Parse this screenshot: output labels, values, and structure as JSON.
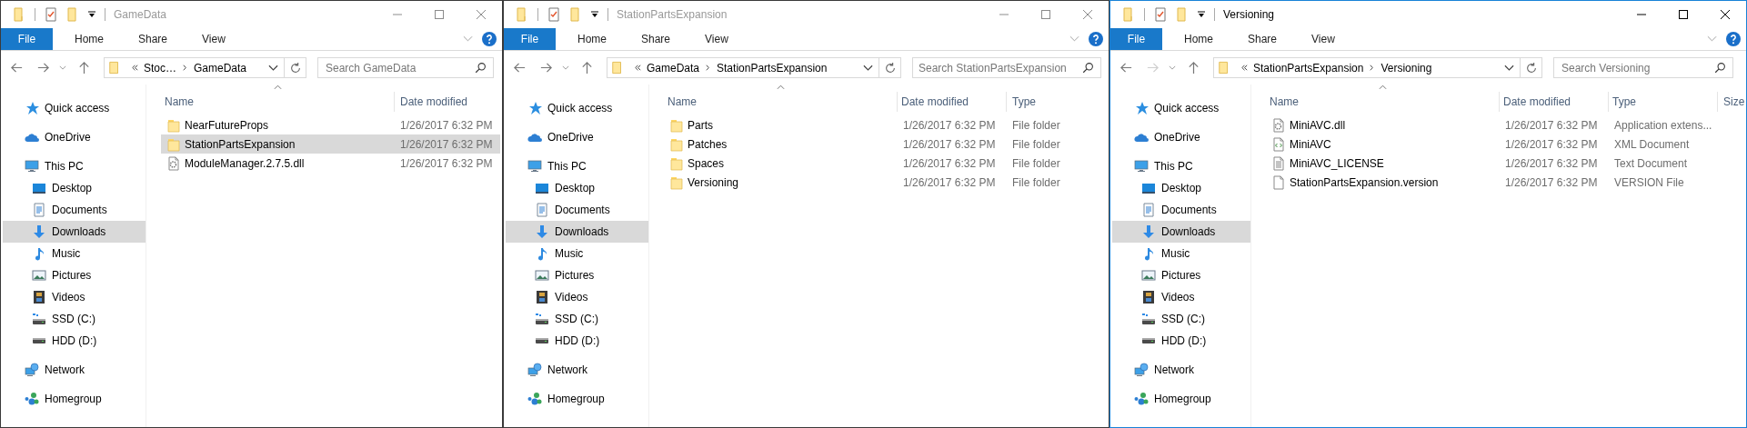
{
  "windows": [
    {
      "title": "GameData",
      "active": false,
      "file_tab": "File",
      "ribbon_tabs": [
        "Home",
        "Share",
        "View"
      ],
      "forward_disabled": false,
      "breadcrumb": [
        "Stoc…",
        "GameData"
      ],
      "search": {
        "placeholder": "Search GameData"
      },
      "columns": [
        "Name",
        "Date modified"
      ],
      "sidebar": [
        {
          "label": "Quick access",
          "kind": "star",
          "selected": false
        },
        {
          "label": "OneDrive",
          "kind": "cloud",
          "selected": false
        },
        {
          "label": "This PC",
          "kind": "computer",
          "selected": false,
          "children": [
            {
              "label": "Desktop",
              "kind": "desktop",
              "selected": false
            },
            {
              "label": "Documents",
              "kind": "documents",
              "selected": false
            },
            {
              "label": "Downloads",
              "kind": "download",
              "selected": true
            },
            {
              "label": "Music",
              "kind": "music",
              "selected": false
            },
            {
              "label": "Pictures",
              "kind": "pictures",
              "selected": false
            },
            {
              "label": "Videos",
              "kind": "videos",
              "selected": false
            },
            {
              "label": "SSD (C:)",
              "kind": "ssd",
              "selected": false
            },
            {
              "label": "HDD (D:)",
              "kind": "hdd",
              "selected": false
            }
          ]
        },
        {
          "label": "Network",
          "kind": "network",
          "selected": false
        },
        {
          "label": "Homegroup",
          "kind": "homegroup",
          "selected": false
        }
      ],
      "files": [
        {
          "name": "NearFutureProps",
          "kind": "folder",
          "date": "1/26/2017 6:32 PM",
          "selected": false
        },
        {
          "name": "StationPartsExpansion",
          "kind": "folder",
          "date": "1/26/2017 6:32 PM",
          "selected": true
        },
        {
          "name": "ModuleManager.2.7.5.dll",
          "kind": "dll",
          "date": "1/26/2017 6:32 PM",
          "selected": false
        }
      ]
    },
    {
      "title": "StationPartsExpansion",
      "active": false,
      "file_tab": "File",
      "ribbon_tabs": [
        "Home",
        "Share",
        "View"
      ],
      "forward_disabled": false,
      "breadcrumb": [
        "GameData",
        "StationPartsExpansion"
      ],
      "search": {
        "placeholder": "Search StationPartsExpansion"
      },
      "columns": [
        "Name",
        "Date modified",
        "Type"
      ],
      "sidebar": [
        {
          "label": "Quick access",
          "kind": "star",
          "selected": false
        },
        {
          "label": "OneDrive",
          "kind": "cloud",
          "selected": false
        },
        {
          "label": "This PC",
          "kind": "computer",
          "selected": false,
          "children": [
            {
              "label": "Desktop",
              "kind": "desktop",
              "selected": false
            },
            {
              "label": "Documents",
              "kind": "documents",
              "selected": false
            },
            {
              "label": "Downloads",
              "kind": "download",
              "selected": true
            },
            {
              "label": "Music",
              "kind": "music",
              "selected": false
            },
            {
              "label": "Pictures",
              "kind": "pictures",
              "selected": false
            },
            {
              "label": "Videos",
              "kind": "videos",
              "selected": false
            },
            {
              "label": "SSD (C:)",
              "kind": "ssd",
              "selected": false
            },
            {
              "label": "HDD (D:)",
              "kind": "hdd",
              "selected": false
            }
          ]
        },
        {
          "label": "Network",
          "kind": "network",
          "selected": false
        },
        {
          "label": "Homegroup",
          "kind": "homegroup",
          "selected": false
        }
      ],
      "files": [
        {
          "name": "Parts",
          "kind": "folder",
          "date": "1/26/2017 6:32 PM",
          "type": "File folder",
          "selected": false
        },
        {
          "name": "Patches",
          "kind": "folder",
          "date": "1/26/2017 6:32 PM",
          "type": "File folder",
          "selected": false
        },
        {
          "name": "Spaces",
          "kind": "folder",
          "date": "1/26/2017 6:32 PM",
          "type": "File folder",
          "selected": false
        },
        {
          "name": "Versioning",
          "kind": "folder",
          "date": "1/26/2017 6:32 PM",
          "type": "File folder",
          "selected": false
        }
      ]
    },
    {
      "title": "Versioning",
      "active": true,
      "file_tab": "File",
      "ribbon_tabs": [
        "Home",
        "Share",
        "View"
      ],
      "forward_disabled": true,
      "breadcrumb": [
        "StationPartsExpansion",
        "Versioning"
      ],
      "search": {
        "placeholder": "Search Versioning"
      },
      "columns": [
        "Name",
        "Date modified",
        "Type",
        "Size"
      ],
      "sidebar": [
        {
          "label": "Quick access",
          "kind": "star",
          "selected": false
        },
        {
          "label": "OneDrive",
          "kind": "cloud",
          "selected": false
        },
        {
          "label": "This PC",
          "kind": "computer",
          "selected": false,
          "children": [
            {
              "label": "Desktop",
              "kind": "desktop",
              "selected": false
            },
            {
              "label": "Documents",
              "kind": "documents",
              "selected": false
            },
            {
              "label": "Downloads",
              "kind": "download",
              "selected": true
            },
            {
              "label": "Music",
              "kind": "music",
              "selected": false
            },
            {
              "label": "Pictures",
              "kind": "pictures",
              "selected": false
            },
            {
              "label": "Videos",
              "kind": "videos",
              "selected": false
            },
            {
              "label": "SSD (C:)",
              "kind": "ssd",
              "selected": false
            },
            {
              "label": "HDD (D:)",
              "kind": "hdd",
              "selected": false
            }
          ]
        },
        {
          "label": "Network",
          "kind": "network",
          "selected": false
        },
        {
          "label": "Homegroup",
          "kind": "homegroup",
          "selected": false
        }
      ],
      "files": [
        {
          "name": "MiniAVC.dll",
          "kind": "dll",
          "date": "1/26/2017 6:32 PM",
          "type": "Application extens...",
          "selected": false
        },
        {
          "name": "MiniAVC",
          "kind": "xml",
          "date": "1/26/2017 6:32 PM",
          "type": "XML Document",
          "selected": false
        },
        {
          "name": "MiniAVC_LICENSE",
          "kind": "text",
          "date": "1/26/2017 6:32 PM",
          "type": "Text Document",
          "selected": false
        },
        {
          "name": "StationPartsExpansion.version",
          "kind": "file",
          "date": "1/26/2017 6:32 PM",
          "type": "VERSION File",
          "selected": false
        }
      ]
    }
  ]
}
